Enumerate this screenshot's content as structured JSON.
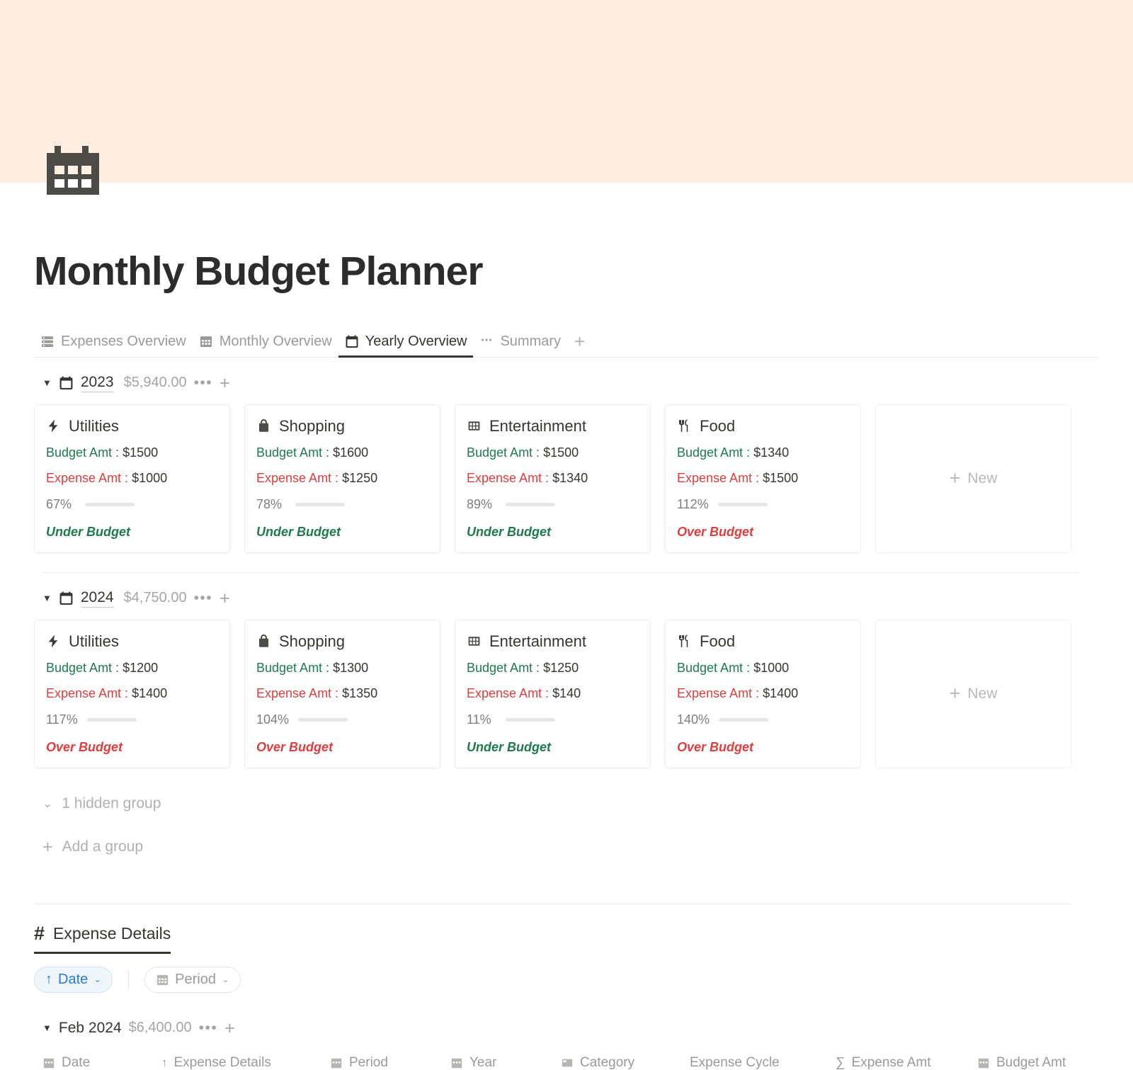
{
  "cover": {
    "icon": "calendar-icon",
    "banner_color": "#ffefe2"
  },
  "header": {
    "title": "Monthly Budget Planner"
  },
  "view_tabs": {
    "items": [
      {
        "label": "Expenses Overview",
        "icon": "list-database-icon",
        "active": false
      },
      {
        "label": "Monthly Overview",
        "icon": "calendar-grid-icon",
        "active": false
      },
      {
        "label": "Yearly Overview",
        "icon": "calendar-icon",
        "active": true
      },
      {
        "label": "Summary",
        "icon": "ellipsis-icon",
        "active": false
      }
    ],
    "add_label": "+"
  },
  "board": {
    "groups": [
      {
        "name": "2023",
        "sum": "$5,940.00",
        "icon": "calendar-icon",
        "caret": "▼",
        "dots": "•••",
        "plus": "+",
        "cards": [
          {
            "title": "Utilities",
            "icon": "bolt-icon",
            "budget_label": "Budget Amt : ",
            "budget_value": "$1500",
            "expense_label": "Expense Amt : ",
            "expense_value": "$1000",
            "percent_text": "67%",
            "percent": 67,
            "status": "Under Budget",
            "status_type": "under"
          },
          {
            "title": "Shopping",
            "icon": "shopping-bag-icon",
            "budget_label": "Budget Amt : ",
            "budget_value": "$1600",
            "expense_label": "Expense Amt : ",
            "expense_value": "$1250",
            "percent_text": "78%",
            "percent": 78,
            "status": "Under Budget",
            "status_type": "under"
          },
          {
            "title": "Entertainment",
            "icon": "film-icon",
            "budget_label": "Budget Amt : ",
            "budget_value": "$1500",
            "expense_label": "Expense Amt : ",
            "expense_value": "$1340",
            "percent_text": "89%",
            "percent": 89,
            "status": "Under Budget",
            "status_type": "under"
          },
          {
            "title": "Food",
            "icon": "fork-knife-icon",
            "budget_label": "Budget Amt : ",
            "budget_value": "$1340",
            "expense_label": "Expense Amt : ",
            "expense_value": "$1500",
            "percent_text": "112%",
            "percent": 100,
            "status": "Over Budget",
            "status_type": "over"
          }
        ],
        "new_card_label": "New"
      },
      {
        "name": "2024",
        "sum": "$4,750.00",
        "icon": "calendar-icon",
        "caret": "▼",
        "dots": "•••",
        "plus": "+",
        "cards": [
          {
            "title": "Utilities",
            "icon": "bolt-icon",
            "budget_label": "Budget Amt : ",
            "budget_value": "$1200",
            "expense_label": "Expense Amt : ",
            "expense_value": "$1400",
            "percent_text": "117%",
            "percent": 100,
            "status": "Over Budget",
            "status_type": "over"
          },
          {
            "title": "Shopping",
            "icon": "shopping-bag-icon",
            "budget_label": "Budget Amt : ",
            "budget_value": "$1300",
            "expense_label": "Expense Amt : ",
            "expense_value": "$1350",
            "percent_text": "104%",
            "percent": 100,
            "status": "Over Budget",
            "status_type": "over"
          },
          {
            "title": "Entertainment",
            "icon": "film-icon",
            "budget_label": "Budget Amt : ",
            "budget_value": "$1250",
            "expense_label": "Expense Amt : ",
            "expense_value": "$140",
            "percent_text": "11%",
            "percent": 11,
            "status": "Under Budget",
            "status_type": "under"
          },
          {
            "title": "Food",
            "icon": "fork-knife-icon",
            "budget_label": "Budget Amt : ",
            "budget_value": "$1000",
            "expense_label": "Expense Amt : ",
            "expense_value": "$1400",
            "percent_text": "140%",
            "percent": 100,
            "status": "Over Budget",
            "status_type": "over"
          }
        ],
        "new_card_label": "New"
      }
    ],
    "hidden_group_label": "1 hidden group",
    "add_group_label": "Add a group"
  },
  "expense_details": {
    "title": "Expense Details",
    "title_icon": "hash-icon",
    "filters": {
      "sort": {
        "label": "Date",
        "icon": "arrow-up-icon",
        "caret": "⌄"
      },
      "property": {
        "label": "Period",
        "icon": "calendar-grid-icon",
        "caret": "⌄"
      }
    },
    "month_group": {
      "caret": "▼",
      "name": "Feb 2024",
      "sum": "$6,400.00",
      "dots": "•••",
      "plus": "+"
    },
    "columns": [
      {
        "label": "Date",
        "icon": "calendar-grid-icon"
      },
      {
        "label": "Expense Details",
        "icon": "arrow-up-icon"
      },
      {
        "label": "Period",
        "icon": "calendar-grid-icon"
      },
      {
        "label": "Year",
        "icon": "calendar-grid-icon"
      },
      {
        "label": "Category",
        "icon": "gallery-icon"
      },
      {
        "label": "Expense Cycle",
        "icon": ""
      },
      {
        "label": "Expense Amt",
        "icon": "sigma-icon"
      },
      {
        "label": "Budget Amt",
        "icon": "calendar-grid-icon"
      }
    ]
  },
  "colors": {
    "banner": "#ffefe2",
    "accent_blue": "#4d87bf",
    "green": "#1f7a4d",
    "red": "#e03e3e",
    "text": "#37352f",
    "muted": "#9b9a97"
  }
}
